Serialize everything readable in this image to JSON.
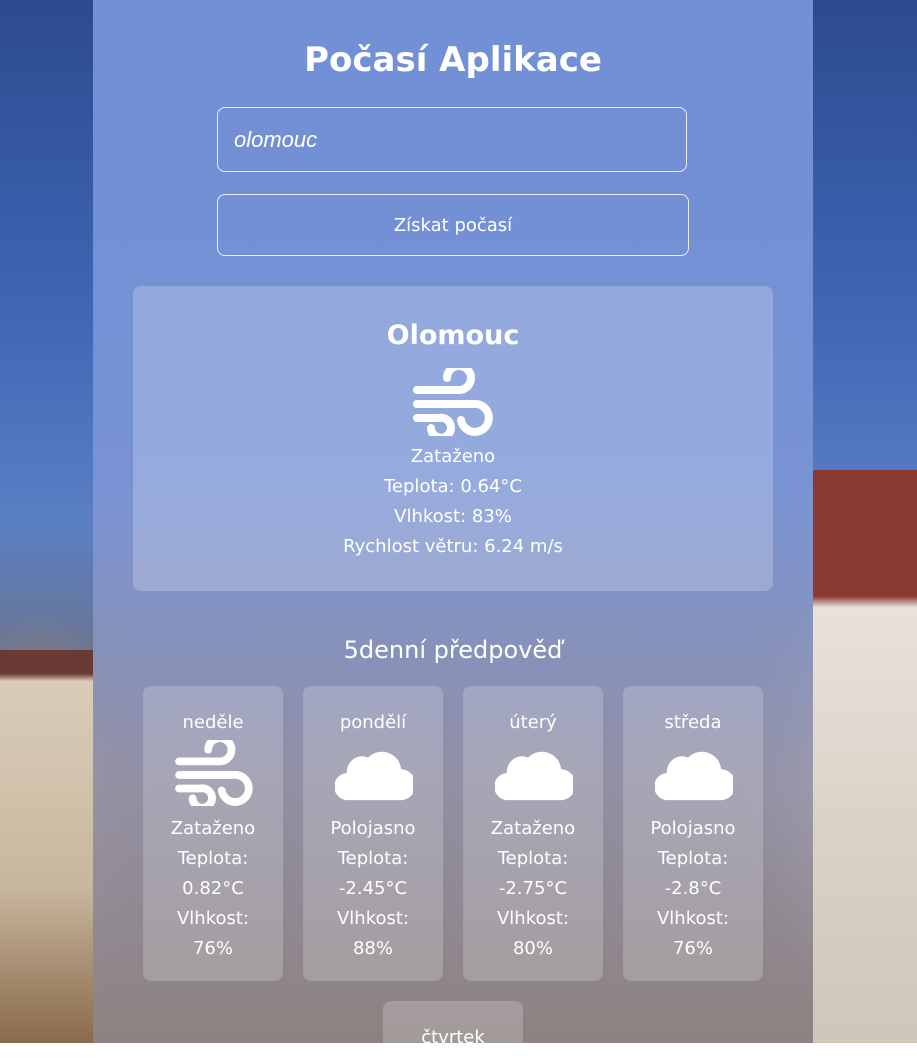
{
  "app": {
    "title": "Počasí Aplikace"
  },
  "search": {
    "value": "olomouc",
    "button_label": "Získat počasí"
  },
  "current": {
    "city": "Olomouc",
    "icon": "wind-icon",
    "description": "Zataženo",
    "temperature": "Teplota: 0.64°C",
    "humidity": "Vlhkost: 83%",
    "wind": "Rychlost větru: 6.24 m/s"
  },
  "forecast": {
    "title": "5denní předpověď",
    "days": [
      {
        "day": "neděle",
        "icon": "wind-icon",
        "description": "Zataženo",
        "temp_label": "Teplota:",
        "temp": "0.82°C",
        "hum_label": "Vlhkost:",
        "hum": "76%"
      },
      {
        "day": "pondělí",
        "icon": "cloud-icon",
        "description": "Polojasno",
        "temp_label": "Teplota:",
        "temp": "-2.45°C",
        "hum_label": "Vlhkost:",
        "hum": "88%"
      },
      {
        "day": "úterý",
        "icon": "cloud-icon",
        "description": "Zataženo",
        "temp_label": "Teplota:",
        "temp": "-2.75°C",
        "hum_label": "Vlhkost:",
        "hum": "80%"
      },
      {
        "day": "středa",
        "icon": "cloud-icon",
        "description": "Polojasno",
        "temp_label": "Teplota:",
        "temp": "-2.8°C",
        "hum_label": "Vlhkost:",
        "hum": "76%"
      },
      {
        "day": "čtvrtek"
      }
    ]
  }
}
